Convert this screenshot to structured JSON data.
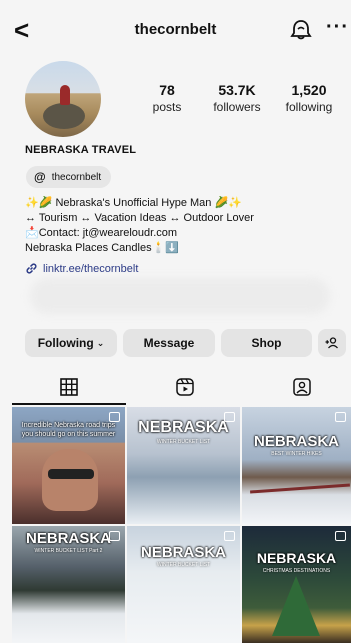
{
  "header": {
    "username": "thecornbelt",
    "back_glyph": "<",
    "more_glyph": "···"
  },
  "profile": {
    "stats": [
      {
        "value": "78",
        "label": "posts"
      },
      {
        "value": "53.7K",
        "label": "followers"
      },
      {
        "value": "1,520",
        "label": "following"
      }
    ],
    "display_name": "NEBRASKA TRAVEL",
    "threads_handle": "thecornbelt",
    "bio_lines": [
      "✨🌽 Nebraska's Unofficial Hype Man 🌽✨",
      "↔ Tourism ↔ Vacation Ideas ↔ Outdoor Lover",
      "📩Contact: jt@weareloudr.com",
      "Nebraska Places Candles🕯️⬇️"
    ],
    "link": "linktr.ee/thecornbelt"
  },
  "actions": {
    "following": "Following",
    "message": "Message",
    "shop": "Shop"
  },
  "grid": {
    "tiles": [
      {
        "title": "Incredible Nebraska road trips you should go on this summer",
        "subtitle": ""
      },
      {
        "title": "NEBRASKA",
        "subtitle": "WINTER BUCKET LIST"
      },
      {
        "title": "NEBRASKA",
        "subtitle": "BEST WINTER HIKES"
      },
      {
        "title": "NEBRASKA",
        "subtitle": "WINTER BUCKET LIST Part 2"
      },
      {
        "title": "NEBRASKA",
        "subtitle": "WINTER BUCKET LIST"
      },
      {
        "title": "NEBRASKA",
        "subtitle": "CHRISTMAS DESTINATIONS"
      }
    ]
  },
  "icons": {
    "back": "back-arrow-icon",
    "notifications": "notification-bell-icon",
    "more": "more-dots-icon",
    "threads": "threads-icon",
    "link": "link-icon",
    "add_person": "add-person-icon",
    "posts_tab": "grid-icon",
    "reels_tab": "reels-icon",
    "tagged_tab": "tagged-icon"
  }
}
